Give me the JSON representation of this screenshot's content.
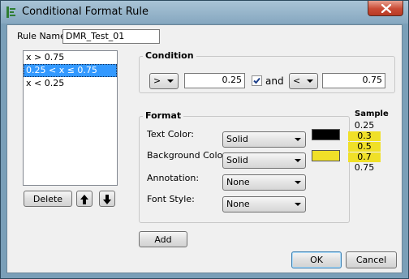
{
  "window": {
    "title": "Conditional Format Rule",
    "close_icon": "close-icon",
    "app_icon": "app-icon"
  },
  "rule_name": {
    "label": "Rule Name:",
    "value": "DMR_Test_01"
  },
  "rules_list": {
    "items": [
      {
        "label": "x > 0.75",
        "selected": false
      },
      {
        "label": "0.25 < x ≤ 0.75",
        "selected": true
      },
      {
        "label": "x < 0.25",
        "selected": false
      }
    ]
  },
  "list_buttons": {
    "delete_label": "Delete",
    "up_icon": "arrow-up-icon",
    "down_icon": "arrow-down-icon"
  },
  "condition": {
    "title": "Condition",
    "op1": ">",
    "value1": "0.25",
    "and_checked": true,
    "and_label": "and",
    "op2": "<",
    "value2": "0.75"
  },
  "format": {
    "title": "Format",
    "text_color_label": "Text Color:",
    "text_color_value": "Solid",
    "text_color_swatch": "#000000",
    "bg_color_label": "Background Color:",
    "bg_color_value": "Solid",
    "bg_color_swatch": "#f0e028",
    "annotation_label": "Annotation:",
    "annotation_value": "None",
    "font_style_label": "Font Style:",
    "font_style_value": "None"
  },
  "sample": {
    "title": "Sample",
    "values": [
      "0.25",
      "0.3",
      "0.5",
      "0.7",
      "0.75"
    ],
    "highlight_color": "#f0e028"
  },
  "add_label": "Add",
  "ok_label": "OK",
  "cancel_label": "Cancel"
}
